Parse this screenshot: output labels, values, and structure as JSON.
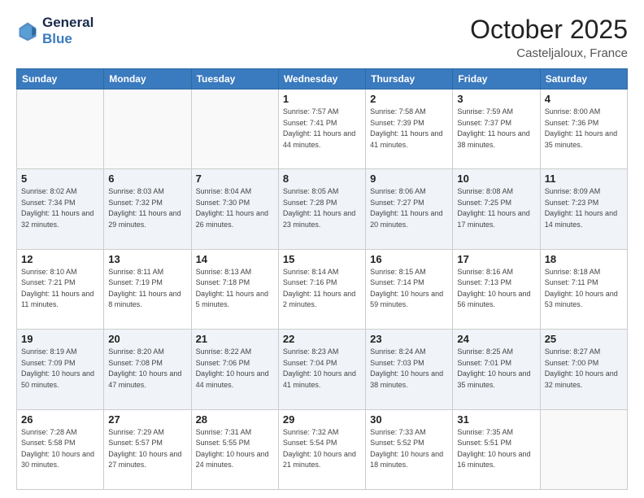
{
  "header": {
    "logo_line1": "General",
    "logo_line2": "Blue",
    "month": "October 2025",
    "location": "Casteljaloux, France"
  },
  "weekdays": [
    "Sunday",
    "Monday",
    "Tuesday",
    "Wednesday",
    "Thursday",
    "Friday",
    "Saturday"
  ],
  "weeks": [
    [
      {
        "day": "",
        "sunrise": "",
        "sunset": "",
        "daylight": ""
      },
      {
        "day": "",
        "sunrise": "",
        "sunset": "",
        "daylight": ""
      },
      {
        "day": "",
        "sunrise": "",
        "sunset": "",
        "daylight": ""
      },
      {
        "day": "1",
        "sunrise": "Sunrise: 7:57 AM",
        "sunset": "Sunset: 7:41 PM",
        "daylight": "Daylight: 11 hours and 44 minutes."
      },
      {
        "day": "2",
        "sunrise": "Sunrise: 7:58 AM",
        "sunset": "Sunset: 7:39 PM",
        "daylight": "Daylight: 11 hours and 41 minutes."
      },
      {
        "day": "3",
        "sunrise": "Sunrise: 7:59 AM",
        "sunset": "Sunset: 7:37 PM",
        "daylight": "Daylight: 11 hours and 38 minutes."
      },
      {
        "day": "4",
        "sunrise": "Sunrise: 8:00 AM",
        "sunset": "Sunset: 7:36 PM",
        "daylight": "Daylight: 11 hours and 35 minutes."
      }
    ],
    [
      {
        "day": "5",
        "sunrise": "Sunrise: 8:02 AM",
        "sunset": "Sunset: 7:34 PM",
        "daylight": "Daylight: 11 hours and 32 minutes."
      },
      {
        "day": "6",
        "sunrise": "Sunrise: 8:03 AM",
        "sunset": "Sunset: 7:32 PM",
        "daylight": "Daylight: 11 hours and 29 minutes."
      },
      {
        "day": "7",
        "sunrise": "Sunrise: 8:04 AM",
        "sunset": "Sunset: 7:30 PM",
        "daylight": "Daylight: 11 hours and 26 minutes."
      },
      {
        "day": "8",
        "sunrise": "Sunrise: 8:05 AM",
        "sunset": "Sunset: 7:28 PM",
        "daylight": "Daylight: 11 hours and 23 minutes."
      },
      {
        "day": "9",
        "sunrise": "Sunrise: 8:06 AM",
        "sunset": "Sunset: 7:27 PM",
        "daylight": "Daylight: 11 hours and 20 minutes."
      },
      {
        "day": "10",
        "sunrise": "Sunrise: 8:08 AM",
        "sunset": "Sunset: 7:25 PM",
        "daylight": "Daylight: 11 hours and 17 minutes."
      },
      {
        "day": "11",
        "sunrise": "Sunrise: 8:09 AM",
        "sunset": "Sunset: 7:23 PM",
        "daylight": "Daylight: 11 hours and 14 minutes."
      }
    ],
    [
      {
        "day": "12",
        "sunrise": "Sunrise: 8:10 AM",
        "sunset": "Sunset: 7:21 PM",
        "daylight": "Daylight: 11 hours and 11 minutes."
      },
      {
        "day": "13",
        "sunrise": "Sunrise: 8:11 AM",
        "sunset": "Sunset: 7:19 PM",
        "daylight": "Daylight: 11 hours and 8 minutes."
      },
      {
        "day": "14",
        "sunrise": "Sunrise: 8:13 AM",
        "sunset": "Sunset: 7:18 PM",
        "daylight": "Daylight: 11 hours and 5 minutes."
      },
      {
        "day": "15",
        "sunrise": "Sunrise: 8:14 AM",
        "sunset": "Sunset: 7:16 PM",
        "daylight": "Daylight: 11 hours and 2 minutes."
      },
      {
        "day": "16",
        "sunrise": "Sunrise: 8:15 AM",
        "sunset": "Sunset: 7:14 PM",
        "daylight": "Daylight: 10 hours and 59 minutes."
      },
      {
        "day": "17",
        "sunrise": "Sunrise: 8:16 AM",
        "sunset": "Sunset: 7:13 PM",
        "daylight": "Daylight: 10 hours and 56 minutes."
      },
      {
        "day": "18",
        "sunrise": "Sunrise: 8:18 AM",
        "sunset": "Sunset: 7:11 PM",
        "daylight": "Daylight: 10 hours and 53 minutes."
      }
    ],
    [
      {
        "day": "19",
        "sunrise": "Sunrise: 8:19 AM",
        "sunset": "Sunset: 7:09 PM",
        "daylight": "Daylight: 10 hours and 50 minutes."
      },
      {
        "day": "20",
        "sunrise": "Sunrise: 8:20 AM",
        "sunset": "Sunset: 7:08 PM",
        "daylight": "Daylight: 10 hours and 47 minutes."
      },
      {
        "day": "21",
        "sunrise": "Sunrise: 8:22 AM",
        "sunset": "Sunset: 7:06 PM",
        "daylight": "Daylight: 10 hours and 44 minutes."
      },
      {
        "day": "22",
        "sunrise": "Sunrise: 8:23 AM",
        "sunset": "Sunset: 7:04 PM",
        "daylight": "Daylight: 10 hours and 41 minutes."
      },
      {
        "day": "23",
        "sunrise": "Sunrise: 8:24 AM",
        "sunset": "Sunset: 7:03 PM",
        "daylight": "Daylight: 10 hours and 38 minutes."
      },
      {
        "day": "24",
        "sunrise": "Sunrise: 8:25 AM",
        "sunset": "Sunset: 7:01 PM",
        "daylight": "Daylight: 10 hours and 35 minutes."
      },
      {
        "day": "25",
        "sunrise": "Sunrise: 8:27 AM",
        "sunset": "Sunset: 7:00 PM",
        "daylight": "Daylight: 10 hours and 32 minutes."
      }
    ],
    [
      {
        "day": "26",
        "sunrise": "Sunrise: 7:28 AM",
        "sunset": "Sunset: 5:58 PM",
        "daylight": "Daylight: 10 hours and 30 minutes."
      },
      {
        "day": "27",
        "sunrise": "Sunrise: 7:29 AM",
        "sunset": "Sunset: 5:57 PM",
        "daylight": "Daylight: 10 hours and 27 minutes."
      },
      {
        "day": "28",
        "sunrise": "Sunrise: 7:31 AM",
        "sunset": "Sunset: 5:55 PM",
        "daylight": "Daylight: 10 hours and 24 minutes."
      },
      {
        "day": "29",
        "sunrise": "Sunrise: 7:32 AM",
        "sunset": "Sunset: 5:54 PM",
        "daylight": "Daylight: 10 hours and 21 minutes."
      },
      {
        "day": "30",
        "sunrise": "Sunrise: 7:33 AM",
        "sunset": "Sunset: 5:52 PM",
        "daylight": "Daylight: 10 hours and 18 minutes."
      },
      {
        "day": "31",
        "sunrise": "Sunrise: 7:35 AM",
        "sunset": "Sunset: 5:51 PM",
        "daylight": "Daylight: 10 hours and 16 minutes."
      },
      {
        "day": "",
        "sunrise": "",
        "sunset": "",
        "daylight": ""
      }
    ]
  ]
}
